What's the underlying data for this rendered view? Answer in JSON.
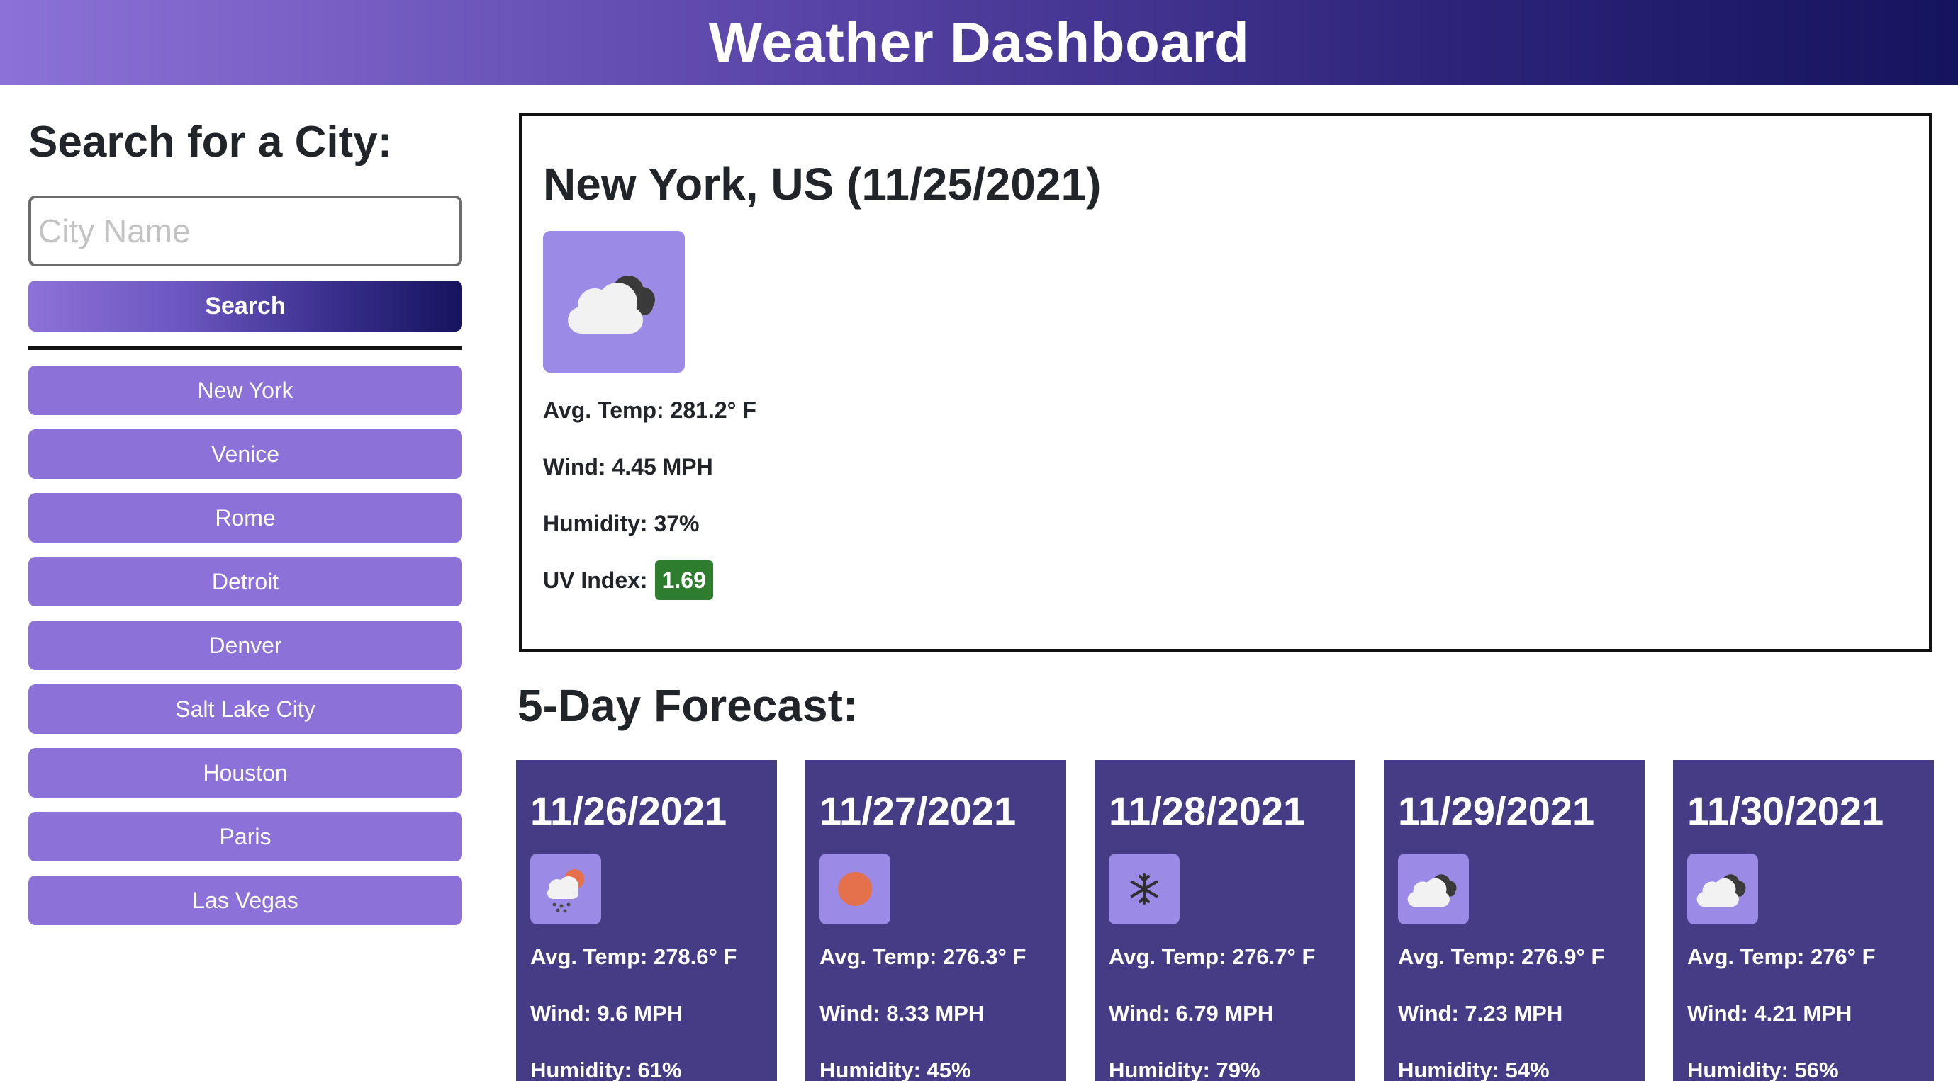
{
  "header": {
    "title": "Weather Dashboard"
  },
  "sidebar": {
    "heading": "Search for a City:",
    "search_placeholder": "City Name",
    "search_label": "Search",
    "history": [
      "New York",
      "Venice",
      "Rome",
      "Detroit",
      "Denver",
      "Salt Lake City",
      "Houston",
      "Paris",
      "Las Vegas"
    ]
  },
  "current": {
    "title": "New York, US (11/25/2021)",
    "icon": "cloudy-icon",
    "temp": "Avg. Temp: 281.2° F",
    "wind": "Wind: 4.45 MPH",
    "humidity": "Humidity: 37%",
    "uv_label": "UV Index:",
    "uv_value": "1.69",
    "uv_color": "#2e7d2e"
  },
  "forecast": {
    "title": "5-Day Forecast:",
    "days": [
      {
        "date": "11/26/2021",
        "icon": "rain-snow-icon",
        "temp": "Avg. Temp: 278.6° F",
        "wind": "Wind: 9.6 MPH",
        "humidity": "Humidity: 61%"
      },
      {
        "date": "11/27/2021",
        "icon": "sun-icon",
        "temp": "Avg. Temp: 276.3° F",
        "wind": "Wind: 8.33 MPH",
        "humidity": "Humidity: 45%"
      },
      {
        "date": "11/28/2021",
        "icon": "snowflake-icon",
        "temp": "Avg. Temp: 276.7° F",
        "wind": "Wind: 6.79 MPH",
        "humidity": "Humidity: 79%"
      },
      {
        "date": "11/29/2021",
        "icon": "cloudy-icon",
        "temp": "Avg. Temp: 276.9° F",
        "wind": "Wind: 7.23 MPH",
        "humidity": "Humidity: 54%"
      },
      {
        "date": "11/30/2021",
        "icon": "cloudy-icon",
        "temp": "Avg. Temp: 276° F",
        "wind": "Wind: 4.21 MPH",
        "humidity": "Humidity: 56%"
      }
    ]
  },
  "colors": {
    "accent": "#8c72d8",
    "header_dark": "#15145e",
    "card_bg": "#463c85",
    "icon_bg": "#9b8ae6"
  }
}
